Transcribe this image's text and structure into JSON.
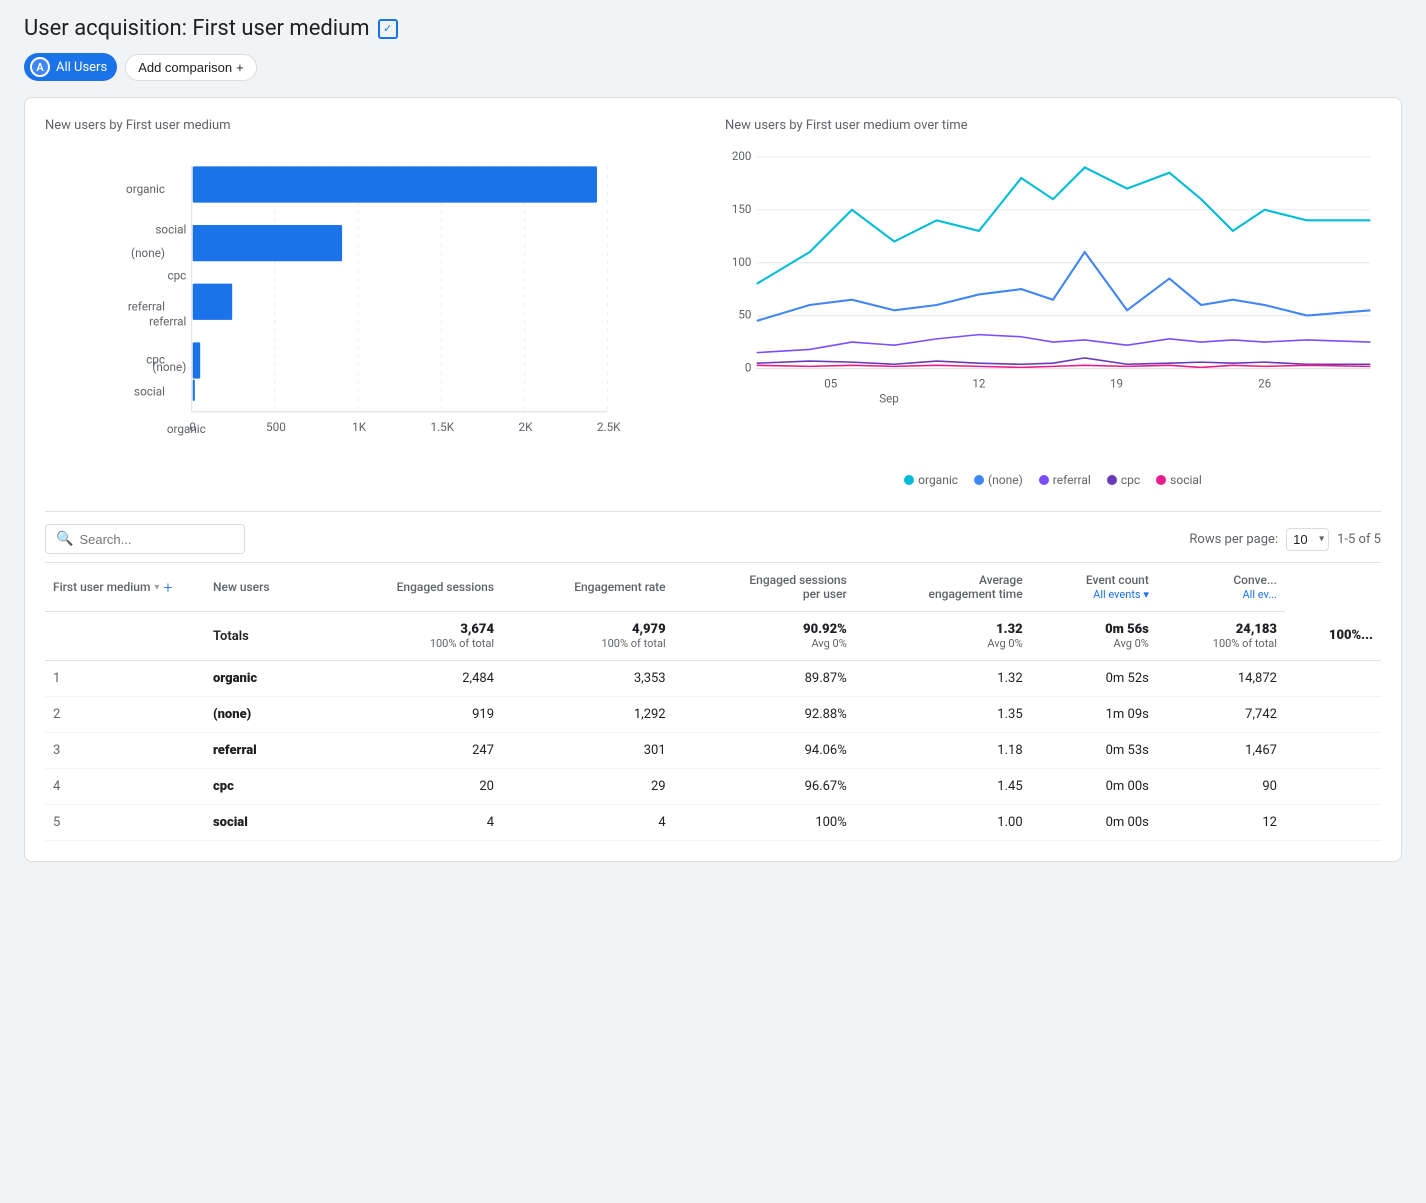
{
  "page": {
    "title": "User acquisition: First user medium",
    "title_icon": "✓"
  },
  "filter": {
    "all_users_label": "All Users",
    "all_users_avatar": "A",
    "add_comparison_label": "Add comparison",
    "add_icon": "+"
  },
  "bar_chart": {
    "title": "New users by First user medium",
    "categories": [
      "organic",
      "(none)",
      "referral",
      "cpc",
      "social"
    ],
    "values": [
      2484,
      919,
      247,
      20,
      4
    ],
    "max_value": 2500,
    "x_labels": [
      "0",
      "500",
      "1K",
      "1.5K",
      "2K",
      "2.5K"
    ],
    "bar_color": "#1a73e8"
  },
  "line_chart": {
    "title": "New users by First user medium over time",
    "y_labels": [
      "200",
      "150",
      "100",
      "50",
      "0"
    ],
    "x_labels": [
      "05",
      "12",
      "19",
      "26"
    ],
    "x_sub_label": "Sep",
    "series": [
      {
        "name": "organic",
        "color": "#00bcd4"
      },
      {
        "name": "(none)",
        "color": "#4285f4"
      },
      {
        "name": "referral",
        "color": "#7c4dff"
      },
      {
        "name": "cpc",
        "color": "#673ab7"
      },
      {
        "name": "social",
        "color": "#e91e8c"
      }
    ]
  },
  "table": {
    "search_placeholder": "Search...",
    "rows_per_page_label": "Rows per page:",
    "rows_per_page_value": "10",
    "pagination_label": "1-5 of 5",
    "columns": [
      {
        "label": "First user medium",
        "has_dropdown": true,
        "has_add": true
      },
      {
        "label": "New users"
      },
      {
        "label": "Engaged sessions"
      },
      {
        "label": "Engagement rate"
      },
      {
        "label": "Engaged sessions per user"
      },
      {
        "label": "Average engagement time"
      },
      {
        "label": "Event count",
        "sub_label": "All events"
      },
      {
        "label": "Conve...",
        "sub_label": "All ev..."
      }
    ],
    "totals": {
      "label": "Totals",
      "new_users": "3,674",
      "new_users_sub": "100% of total",
      "engaged_sessions": "4,979",
      "engaged_sessions_sub": "100% of total",
      "engagement_rate": "90.92%",
      "engagement_rate_sub": "Avg 0%",
      "engaged_sessions_per_user": "1.32",
      "engaged_sessions_per_user_sub": "Avg 0%",
      "avg_engagement_time": "0m 56s",
      "avg_engagement_time_sub": "Avg 0%",
      "event_count": "24,183",
      "event_count_sub": "100% of total",
      "conversions": "100%..."
    },
    "rows": [
      {
        "rank": "1",
        "medium": "organic",
        "new_users": "2,484",
        "engaged_sessions": "3,353",
        "engagement_rate": "89.87%",
        "esp_user": "1.32",
        "avg_time": "0m 52s",
        "event_count": "14,872",
        "conversions": ""
      },
      {
        "rank": "2",
        "medium": "(none)",
        "new_users": "919",
        "engaged_sessions": "1,292",
        "engagement_rate": "92.88%",
        "esp_user": "1.35",
        "avg_time": "1m 09s",
        "event_count": "7,742",
        "conversions": ""
      },
      {
        "rank": "3",
        "medium": "referral",
        "new_users": "247",
        "engaged_sessions": "301",
        "engagement_rate": "94.06%",
        "esp_user": "1.18",
        "avg_time": "0m 53s",
        "event_count": "1,467",
        "conversions": ""
      },
      {
        "rank": "4",
        "medium": "cpc",
        "new_users": "20",
        "engaged_sessions": "29",
        "engagement_rate": "96.67%",
        "esp_user": "1.45",
        "avg_time": "0m 00s",
        "event_count": "90",
        "conversions": ""
      },
      {
        "rank": "5",
        "medium": "social",
        "new_users": "4",
        "engaged_sessions": "4",
        "engagement_rate": "100%",
        "esp_user": "1.00",
        "avg_time": "0m 00s",
        "event_count": "12",
        "conversions": ""
      }
    ]
  }
}
